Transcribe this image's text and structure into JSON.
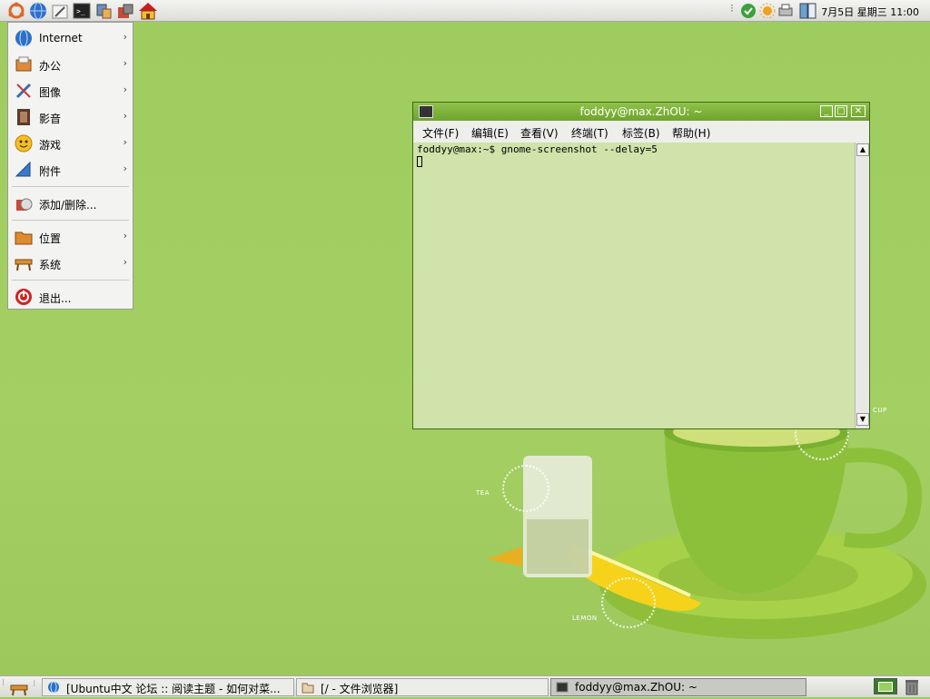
{
  "top_panel": {
    "launchers": [
      "ubuntu-logo-icon",
      "globe-icon",
      "pen-icon",
      "terminal-icon",
      "network-icon",
      "package-icon",
      "home-icon"
    ],
    "clock": "7月5日 星期三 11:00"
  },
  "app_menu": {
    "items": [
      {
        "label": "Internet",
        "icon": "globe-icon",
        "submenu": true
      },
      {
        "label": "办公",
        "icon": "office-icon",
        "submenu": true
      },
      {
        "label": "图像",
        "icon": "graphics-icon",
        "submenu": true
      },
      {
        "label": "影音",
        "icon": "film-icon",
        "submenu": true
      },
      {
        "label": "游戏",
        "icon": "games-icon",
        "submenu": true
      },
      {
        "label": "附件",
        "icon": "accessories-icon",
        "submenu": true
      },
      {
        "label": "添加/删除...",
        "icon": "add-remove-icon",
        "submenu": false
      },
      {
        "label": "位置",
        "icon": "folder-icon",
        "submenu": true
      },
      {
        "label": "系统",
        "icon": "system-icon",
        "submenu": true
      },
      {
        "label": "退出...",
        "icon": "power-icon",
        "submenu": false
      }
    ],
    "arrow": "›"
  },
  "terminal": {
    "title": "foddyy@max.ZhOU: ~",
    "menus": [
      "文件(F)",
      "编辑(E)",
      "查看(V)",
      "终端(T)",
      "标签(B)",
      "帮助(H)"
    ],
    "prompt_line": "foddyy@max:~$ gnome-screenshot --delay=5",
    "buttons": {
      "minimize": "_",
      "maximize": "□",
      "close": "✕"
    }
  },
  "wallpaper": {
    "labels": {
      "tea": "TEA",
      "cup": "CUP",
      "lemon": "LEMON"
    }
  },
  "taskbar": {
    "tasks": [
      {
        "label": "[Ubuntu中文 论坛 :: 阅读主题 - 如何对菜...",
        "icon": "globe-icon"
      },
      {
        "label": "[/ - 文件浏览器]",
        "icon": "folder-icon"
      },
      {
        "label": "foddyy@max.ZhOU: ~",
        "icon": "terminal-icon"
      }
    ]
  },
  "colors": {
    "accent": "#7ab437",
    "desktop": "#9ecb5e"
  }
}
